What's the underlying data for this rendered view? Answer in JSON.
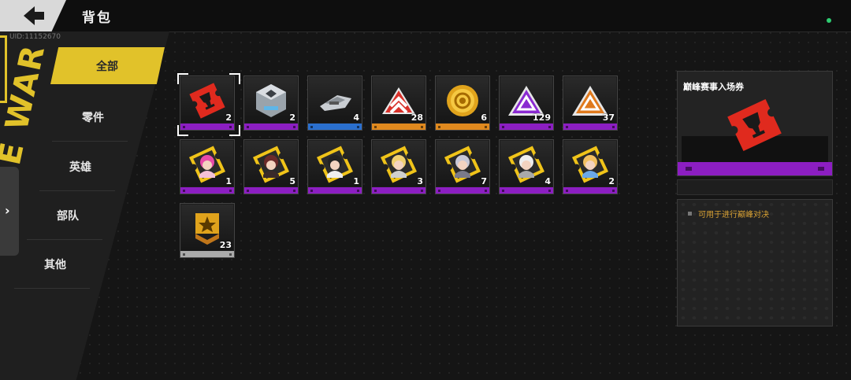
{
  "header": {
    "title": "背包",
    "uid": "UID:11152670"
  },
  "sidebar": {
    "items": [
      "全部",
      "零件",
      "英雄",
      "部队",
      "其他"
    ],
    "active": 0
  },
  "inventory": {
    "items": [
      {
        "icon": "red-ticket-icon",
        "count": "2",
        "rarity": "#8c1ec2"
      },
      {
        "icon": "silver-chest-icon",
        "count": "2",
        "rarity": "#8c1ec2"
      },
      {
        "icon": "metal-parts-icon",
        "count": "4",
        "rarity": "#2a6fce"
      },
      {
        "icon": "red-rank-chevron-icon",
        "count": "28",
        "rarity": "#e0891e"
      },
      {
        "icon": "gold-coin-icon",
        "count": "6",
        "rarity": "#e0891e"
      },
      {
        "icon": "purple-triangle-icon",
        "count": "129",
        "rarity": "#8c1ec2"
      },
      {
        "icon": "orange-triangle-icon",
        "count": "37",
        "rarity": "#8c1ec2"
      },
      {
        "icon": "hero-ticket-pink-icon",
        "count": "1",
        "rarity": "#8c1ec2"
      },
      {
        "icon": "hero-ticket-dark-icon",
        "count": "5",
        "rarity": "#8c1ec2"
      },
      {
        "icon": "hero-ticket-black-icon",
        "count": "1",
        "rarity": "#8c1ec2"
      },
      {
        "icon": "hero-ticket-blonde-icon",
        "count": "3",
        "rarity": "#8c1ec2"
      },
      {
        "icon": "hero-ticket-silver-icon",
        "count": "7",
        "rarity": "#8c1ec2"
      },
      {
        "icon": "hero-ticket-white-icon",
        "count": "4",
        "rarity": "#8c1ec2"
      },
      {
        "icon": "hero-ticket-blue-icon",
        "count": "2",
        "rarity": "#8c1ec2"
      },
      {
        "icon": "gold-star-badge-icon",
        "count": "23",
        "rarity": "#aaaaaa"
      }
    ]
  },
  "detail": {
    "name": "巅峰赛事入场券",
    "description": "可用于进行巅峰对决",
    "rarity": "#8c1ec2"
  },
  "colors": {
    "accent": "#e1c22a"
  }
}
